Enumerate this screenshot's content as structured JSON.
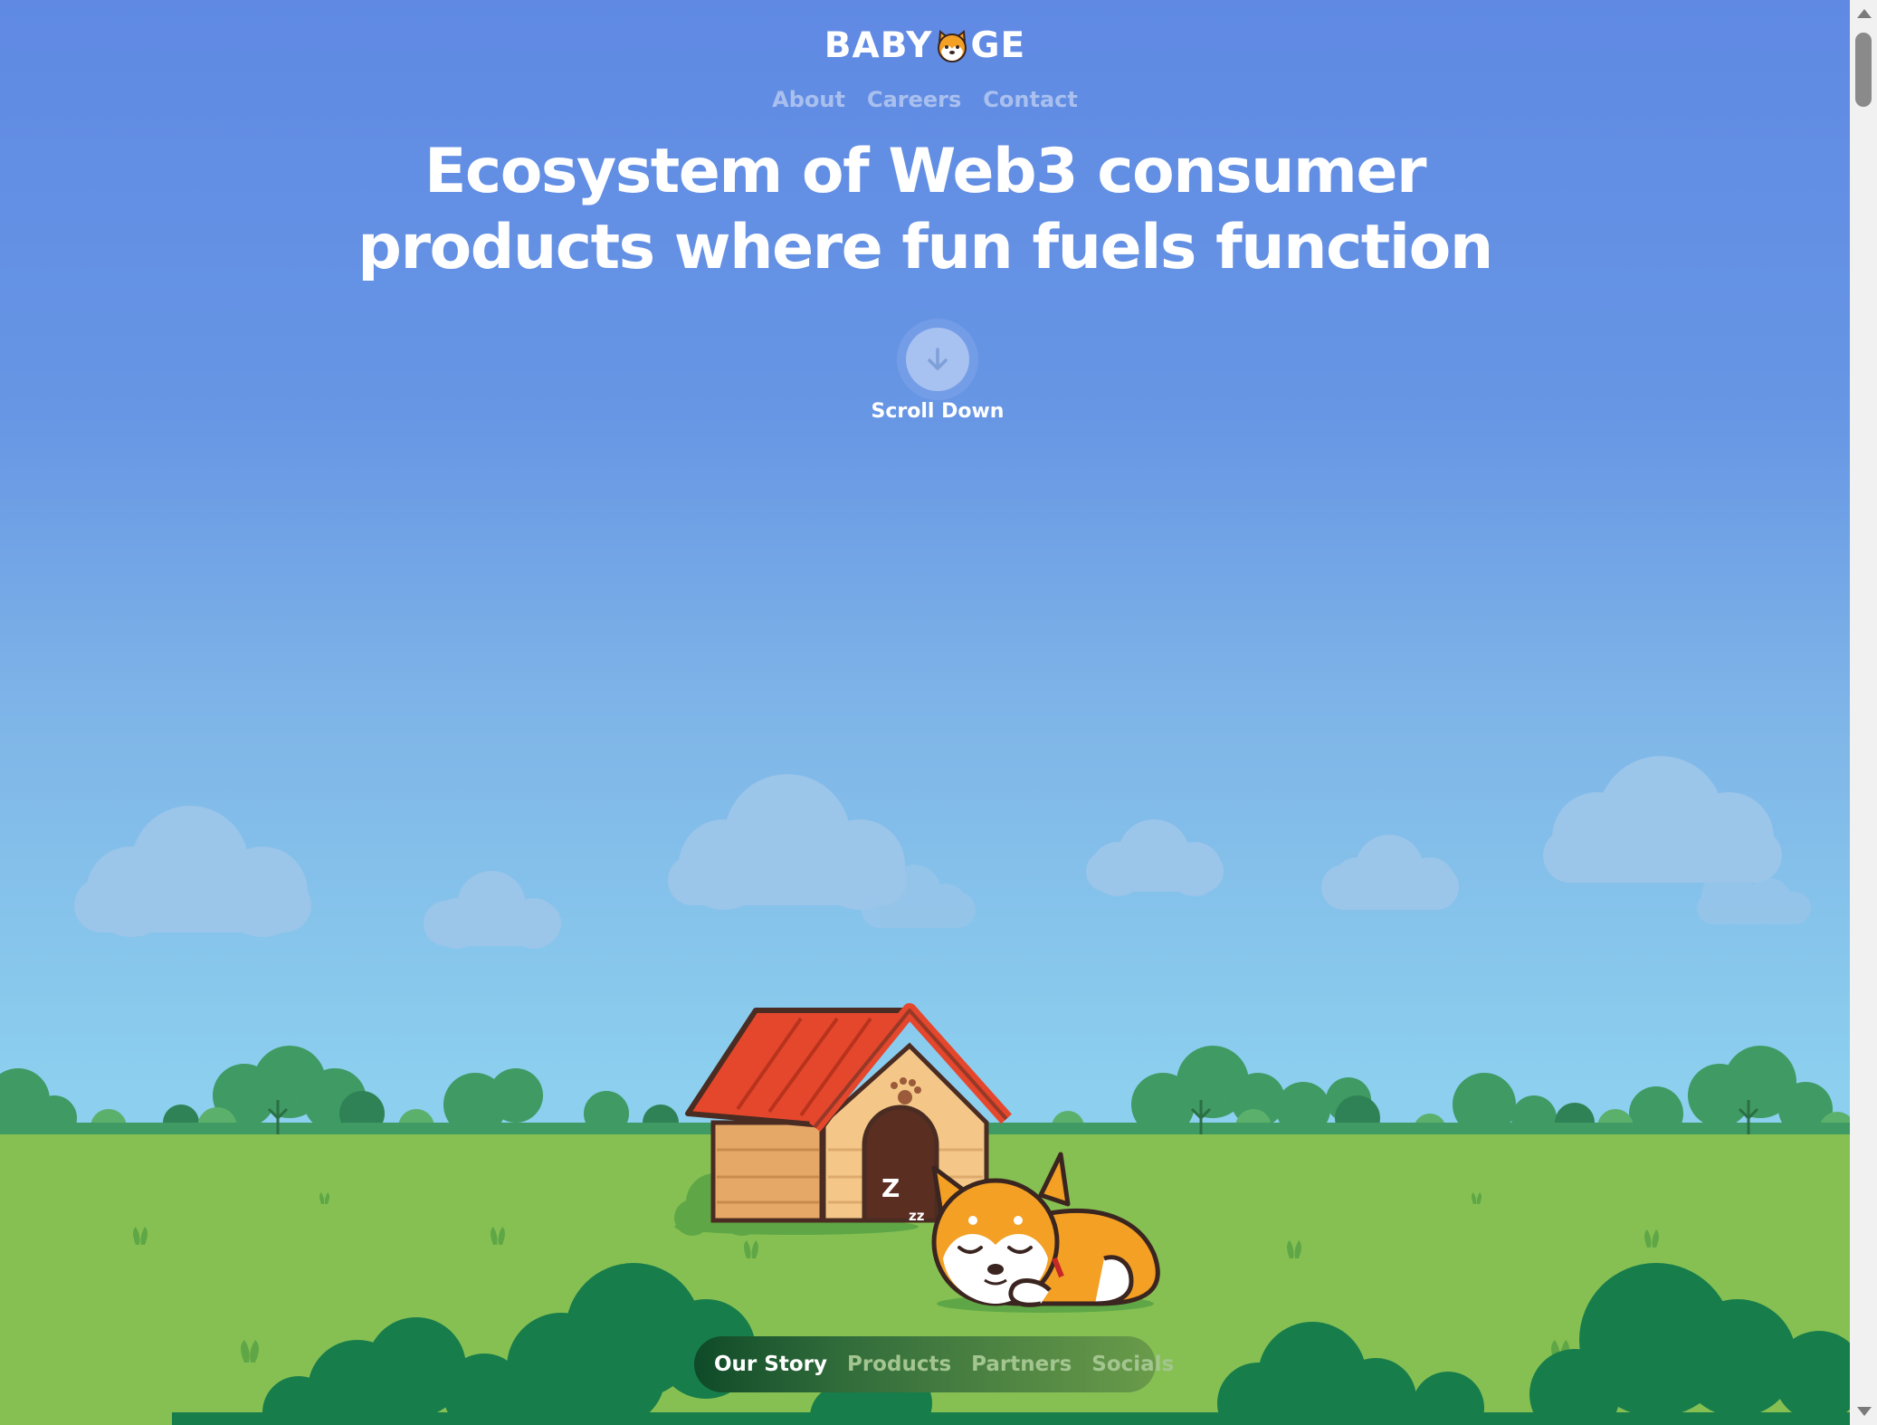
{
  "brand": {
    "logo_left": "BABY",
    "logo_right": "GE"
  },
  "top_nav": [
    {
      "label": "About"
    },
    {
      "label": "Careers"
    },
    {
      "label": "Contact"
    }
  ],
  "hero": {
    "title_line1": "Ecosystem of Web3 consumer",
    "title_line2": "products where fun fuels function",
    "scroll_label": "Scroll Down"
  },
  "scene": {
    "sleep_text": "Z",
    "sleep_small": "zz"
  },
  "section_nav": [
    {
      "label": "Our Story",
      "active": true
    },
    {
      "label": "Products",
      "active": false
    },
    {
      "label": "Partners",
      "active": false
    },
    {
      "label": "Socials",
      "active": false
    }
  ],
  "colors": {
    "sky_top": "#5f89e3",
    "sky_bottom": "#8ccfee",
    "grass": "#86c053",
    "roof": "#e5472d",
    "bush_dark": "#177d4b",
    "dog_orange": "#f3a024"
  }
}
